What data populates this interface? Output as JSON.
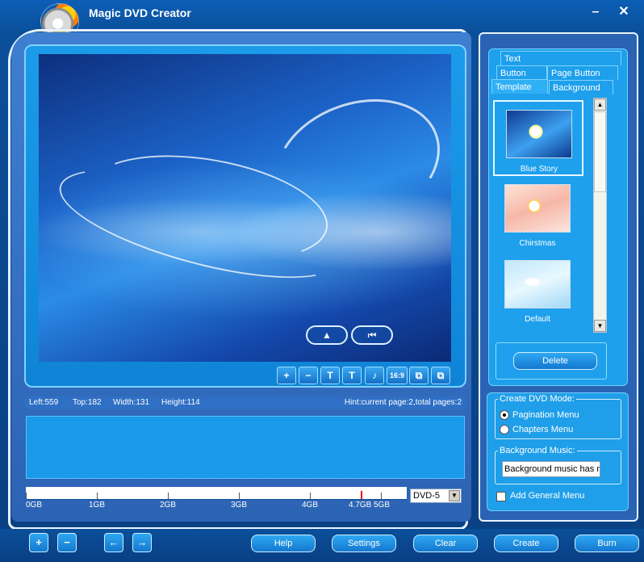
{
  "title": "Magic DVD Creator",
  "logo_text": "DVD",
  "window_buttons": {
    "minimize": "–",
    "close": "✕"
  },
  "preview": {
    "nav_up": "▲",
    "nav_first": "⏮"
  },
  "tools": [
    "+",
    "−",
    "T",
    "T",
    "♪",
    "16:9",
    "⧉",
    "⧉"
  ],
  "status": {
    "left": "Left:559",
    "top": "Top:182",
    "width": "Width:131",
    "height": "Height:114",
    "hint": "Hint:current page:2,total pages:2"
  },
  "ruler": {
    "labels": [
      "0GB",
      "1GB",
      "2GB",
      "3GB",
      "4GB",
      "4.7GB",
      "5GB"
    ],
    "disc_type": "DVD-5"
  },
  "tabs": {
    "text": "Text",
    "button": "Button",
    "page_button": "Page Button",
    "template": "Template",
    "background": "Background"
  },
  "templates": [
    {
      "name": "Blue Story"
    },
    {
      "name": "Chirstmas"
    },
    {
      "name": "Default"
    }
  ],
  "delete_label": "Delete",
  "dvd_mode": {
    "title": "Create DVD Mode:",
    "options": [
      "Pagination Menu",
      "Chapters Menu"
    ],
    "selected": "Pagination Menu"
  },
  "bg_music": {
    "title": "Background Music:",
    "value": "Background music has no"
  },
  "general_menu": "Add General Menu",
  "bottom": {
    "add_icon": "+",
    "remove_icon": "−",
    "back_icon": "←",
    "forward_icon": "→",
    "help": "Help",
    "settings": "Settings",
    "clear": "Clear",
    "create": "Create",
    "burn": "Burn"
  }
}
